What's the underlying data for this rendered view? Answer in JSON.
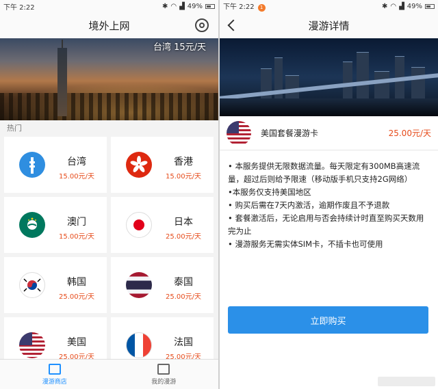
{
  "left": {
    "status": {
      "time": "下午 2:22",
      "battery": "49%"
    },
    "title": "境外上网",
    "banner_label": "台湾 15元/天",
    "section_hot": "热门",
    "destinations": [
      {
        "name": "台湾",
        "price": "15.00元/天",
        "icon": "taiwan-101-icon"
      },
      {
        "name": "香港",
        "price": "15.00元/天",
        "icon": "hong-kong-flag-icon"
      },
      {
        "name": "澳门",
        "price": "15.00元/天",
        "icon": "macau-flag-icon"
      },
      {
        "name": "日本",
        "price": "25.00元/天",
        "icon": "japan-flag-icon"
      },
      {
        "name": "韩国",
        "price": "25.00元/天",
        "icon": "korea-flag-icon"
      },
      {
        "name": "泰国",
        "price": "25.00元/天",
        "icon": "thailand-flag-icon"
      },
      {
        "name": "美国",
        "price": "25.00元/天",
        "icon": "usa-flag-icon"
      },
      {
        "name": "法国",
        "price": "25.00元/天",
        "icon": "france-flag-icon"
      }
    ],
    "tabs": [
      {
        "label": "漫游商店",
        "active": true
      },
      {
        "label": "我的漫游",
        "active": false
      }
    ]
  },
  "right": {
    "status": {
      "time": "下午 2:22",
      "battery": "49%",
      "notif_count": "1"
    },
    "title": "漫游详情",
    "product": {
      "name": "美国套餐漫游卡",
      "price": "25.00元/天"
    },
    "description": [
      "• 本服务提供无限数据流量。每天限定有300MB高速流量，超过后则给予限速（移动版手机只支持2G网络）",
      "•本服务仅支持美国地区",
      "• 购买后需在7天内激活，逾期作废且不予退款",
      "• 套餐激活后，无论启用与否会持续计时直至购买天数用完为止",
      "• 漫游服务无需实体SIM卡，不插卡也可使用"
    ],
    "buy_label": "立即购买"
  },
  "colors": {
    "accent": "#2b90e8",
    "price": "#e64a19",
    "tab_active": "#1e90ff"
  }
}
